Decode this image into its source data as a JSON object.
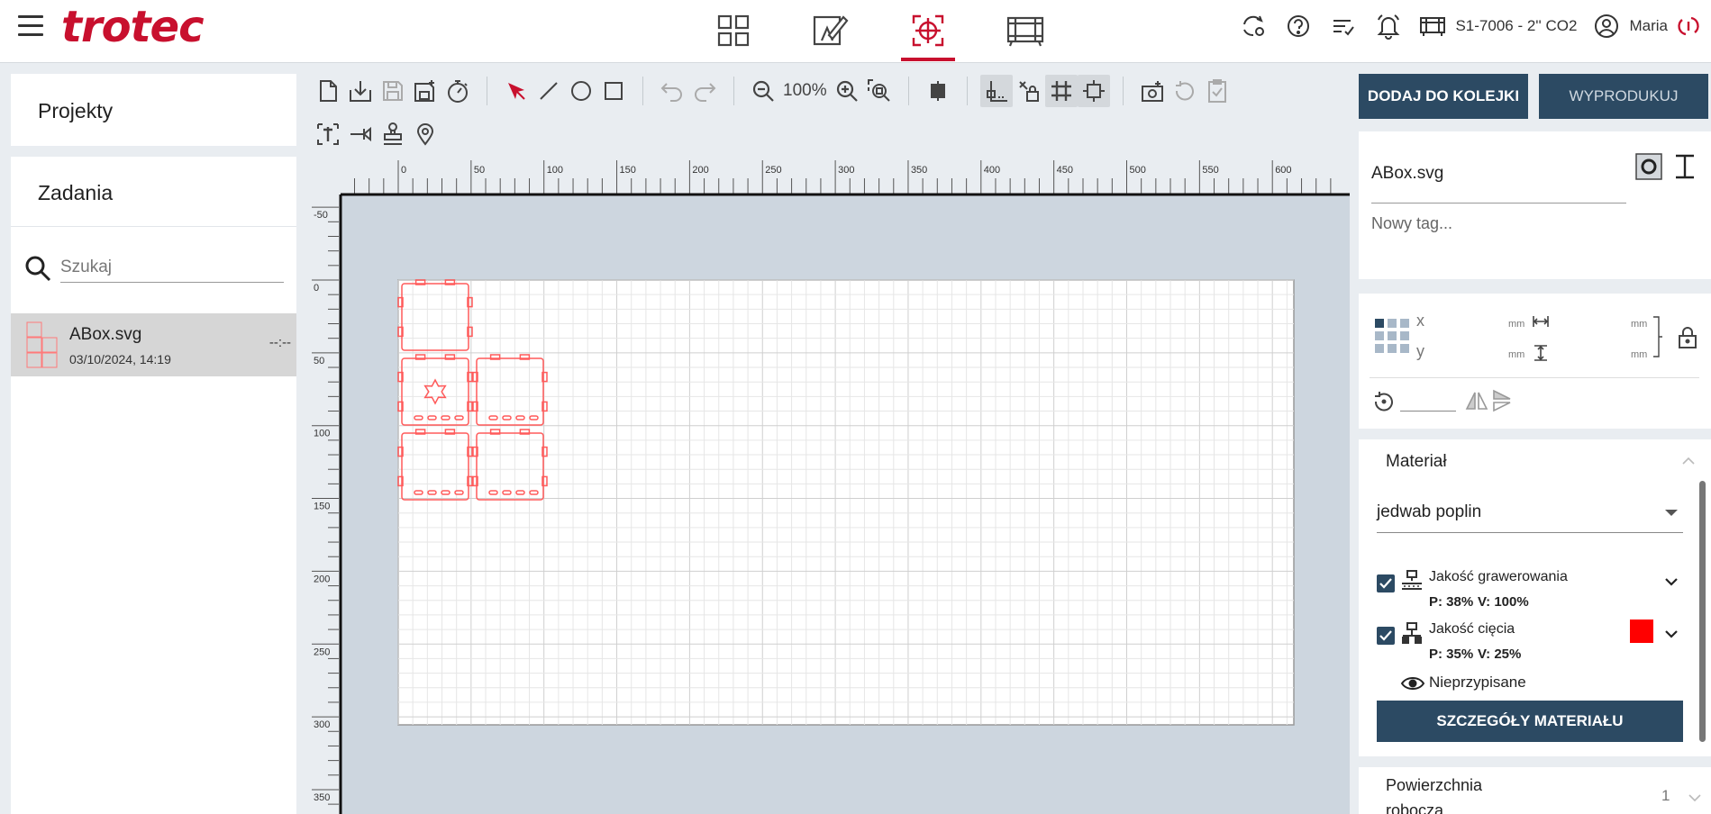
{
  "header": {
    "logo": "trotec",
    "machine_label": "S1-7006 - 2'' CO2",
    "user_name": "Maria",
    "nav_icons": [
      "dashboard-icon",
      "design-icon",
      "laser-target-icon",
      "film-icon"
    ],
    "active_tab": 2
  },
  "sidebar": {
    "projects_label": "Projekty",
    "jobs_label": "Zadania",
    "search_placeholder": "Szukaj",
    "jobs": [
      {
        "name": "ABox.svg",
        "date": "03/10/2024, 14:19",
        "time": "--:--"
      }
    ]
  },
  "toolbar": {
    "zoom_level": "100%"
  },
  "canvas": {
    "ruler_x": [
      "0",
      "50",
      "100",
      "150",
      "200",
      "250",
      "300",
      "350",
      "400",
      "450",
      "500",
      "550",
      "600"
    ],
    "ruler_y": [
      "-50",
      "0",
      "50",
      "100",
      "150",
      "200",
      "250",
      "300",
      "350"
    ]
  },
  "right_panel": {
    "add_to_queue": "DODAJ DO KOLEJKI",
    "produce": "WYPRODUKUJ",
    "file_name": "ABox.svg",
    "tag_placeholder": "Nowy tag...",
    "x_label": "x",
    "y_label": "y",
    "unit": "mm",
    "material_title": "Materiał",
    "material_value": "jedwab poplin",
    "qualities": [
      {
        "label": "Jakość grawerowania",
        "power": "P: 38%",
        "velocity": "V: 100%",
        "checked": true
      },
      {
        "label": "Jakość cięcia",
        "power": "P: 35%",
        "velocity": "V: 25%",
        "checked": true,
        "color": "#ff0000"
      }
    ],
    "unassigned_label": "Nieprzypisane",
    "details_button": "SZCZEGÓŁY MATERIAŁU",
    "surface_label_1": "Powierzchnia",
    "surface_label_2": "robocza",
    "surface_count": "1"
  },
  "colors": {
    "brand": "#c8102e",
    "primary_button": "#2c4a63",
    "cut_outline": "#ff5a5a"
  }
}
